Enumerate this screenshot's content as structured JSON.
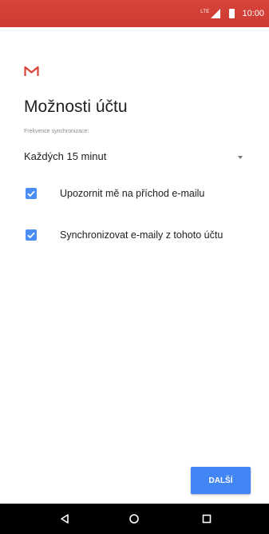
{
  "status_bar": {
    "network": "LTE",
    "time": "10:00",
    "background_color": "#d8443b"
  },
  "app_logo": {
    "icon": "gmail-icon",
    "color": "#db4437"
  },
  "page": {
    "title": "Možnosti účtu",
    "sync_frequency_label": "Frekvence synchronizace:",
    "sync_frequency_value": "Každých 15 minut"
  },
  "options": [
    {
      "label": "Upozornit mě na příchod e-mailu",
      "checked": true
    },
    {
      "label": "Synchronizovat e-maily z tohoto účtu",
      "checked": true
    }
  ],
  "actions": {
    "next_label": "DALŠÍ",
    "accent_color": "#4285f4"
  },
  "nav_bar": {
    "icons": [
      "back-icon",
      "home-icon",
      "recents-icon"
    ]
  }
}
